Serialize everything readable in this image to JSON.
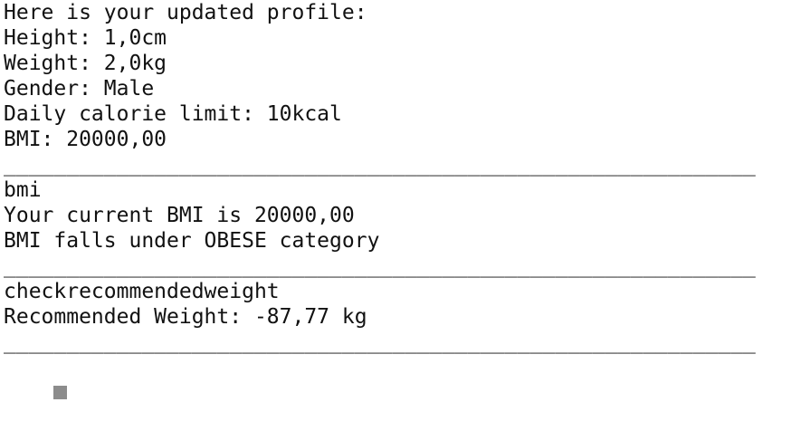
{
  "profile": {
    "header": "Here is your updated profile:",
    "height": "Height: 1,0cm",
    "weight": "Weight: 2,0kg",
    "gender": "Gender: Male",
    "calorie_limit": "Daily calorie limit: 10kcal",
    "bmi": "BMI: 20000,00"
  },
  "separator": "____________________________________________________________",
  "bmi_section": {
    "command": "bmi",
    "current": "Your current BMI is 20000,00",
    "category": "BMI falls under OBESE category"
  },
  "recommend_section": {
    "command": "checkrecommendedweight",
    "result": "Recommended Weight: -87,77 kg"
  },
  "colors": {
    "text": "#111111",
    "cursor": "#8c8c8c",
    "background": "#ffffff"
  }
}
